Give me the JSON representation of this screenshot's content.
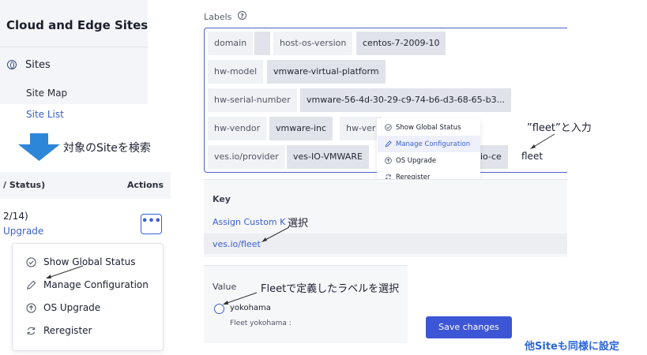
{
  "sidebar": {
    "title": "Cloud and Edge Sites",
    "section": {
      "icon": "globe-icon",
      "label": "Sites"
    },
    "items": [
      {
        "label": "Site Map"
      },
      {
        "label": "Site List"
      }
    ]
  },
  "annotations": {
    "search_target": "対象のSiteを検索",
    "type_fleet": "”fleet”と入力",
    "select": "選択",
    "select_fleet_label": "Fleetで定義したラベルを選択",
    "other_sites": "他Siteも同様に設定"
  },
  "table": {
    "col_status": "/ Status)",
    "col_actions": "Actions",
    "row": {
      "count": "2/14)",
      "upgrade": "Upgrade",
      "actions_icon": "•••"
    }
  },
  "actions_menu": [
    {
      "icon": "check-circle-icon",
      "label": "Show Global Status"
    },
    {
      "icon": "pencil-icon",
      "label": "Manage Configuration"
    },
    {
      "icon": "arrow-up-circle-icon",
      "label": "OS Upgrade"
    },
    {
      "icon": "refresh-icon",
      "label": "Reregister"
    }
  ],
  "labels": {
    "caption": "Labels",
    "chips": [
      {
        "key": "domain",
        "value": ""
      },
      {
        "key": "host-os-version",
        "value": "centos-7-2009-10"
      },
      {
        "key": "hw-model",
        "value": "vmware-virtual-platform"
      },
      {
        "key": "hw-serial-number",
        "value": "vmware-56-4d-30-29-c9-74-b6-d3-68-65-b3..."
      },
      {
        "key": "hw-vendor",
        "value": "vmware-inc"
      },
      {
        "key": "hw-ver",
        "value": ""
      },
      {
        "key": "ves.io/provider",
        "value": "ves-IO-VMWARE"
      },
      {
        "key": "",
        "value": "io-ce"
      }
    ],
    "typed_input": "fleet"
  },
  "key_panel": {
    "caption": "Key",
    "assign_custom": "Assign Custom K",
    "selected_key": "ves.io/fleet"
  },
  "value_panel": {
    "caption": "Value",
    "option_label": "yokohama",
    "option_desc": "Fleet yokohama :"
  },
  "save_button": "Save changes"
}
